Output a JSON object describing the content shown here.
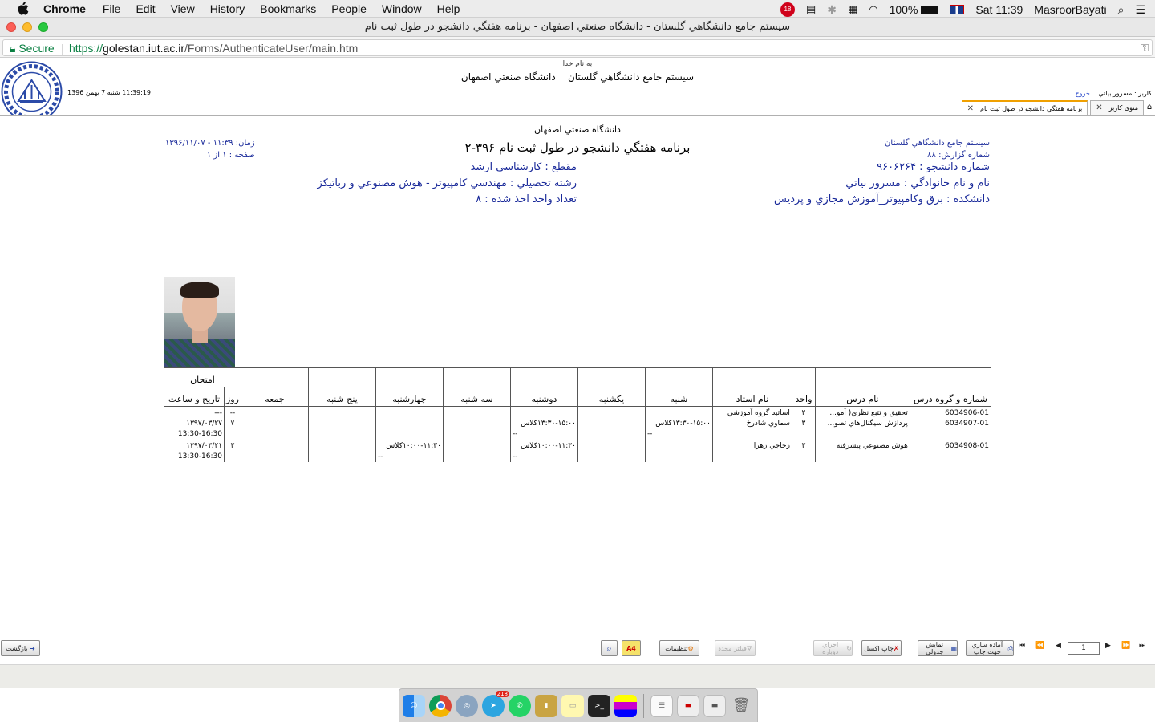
{
  "menubar": {
    "app_name": "Chrome",
    "menus": [
      "File",
      "Edit",
      "View",
      "History",
      "Bookmarks",
      "People",
      "Window",
      "Help"
    ],
    "badge_count": "18",
    "battery": "100%",
    "clock": "Sat 11:39",
    "user": "MasroorBayati"
  },
  "window": {
    "title": "سيستم جامع دانشگاهي گلستان - دانشگاه صنعتي اصفهان - برنامه هفتگي دانشجو در طول ثبت نام"
  },
  "address": {
    "secure_label": "Secure",
    "url_scheme": "https://",
    "url_host": "golestan.iut.ac.ir",
    "url_path": "/Forms/AuthenticateUser/main.htm"
  },
  "header": {
    "basmala": "به نام خدا",
    "system_name": "سيستم جامع دانشگاهي گلستان",
    "university": "دانشگاه صنعتي اصفهان",
    "clock_text": "11:39:19 شنبه 7 بهمن 1396",
    "user_label": "كاربر : مسرور بياتي",
    "logout_label": "خروج"
  },
  "tabs": [
    {
      "label": "برنامه هفتگي دانشجو در طول ثبت نام",
      "active": true
    },
    {
      "label": "منوی کاربر",
      "active": false
    }
  ],
  "report": {
    "university": "دانشگاه صنعتي اصفهان",
    "title": "برنامه هفتگي دانشجو در طول ثبت نام ۳۹۶-۲",
    "system_name": "سيستم جامع دانشگاهي گلستان",
    "report_number": "شماره گزارش: ۸۸",
    "time": "زمان: ۱۱:۳۹ - ۱۳۹۶/۱۱/۰۷",
    "page": "صفحه : ۱ از ۱",
    "student_number": "شماره دانشجو : ۹۶۰۶۲۶۴",
    "student_name": "نام و نام خانوادگي : مسرور بياتي",
    "faculty": "دانشكده : برق وكامپيوتر_آموزش مجازي و پرديس",
    "grade": "مقطع : كارشناسي ارشد",
    "major": "رشته تحصيلي : مهندسي كامپيوتر - هوش مصنوعي و رباتيكز",
    "units_taken": "تعداد واحد اخذ شده : ۸"
  },
  "table": {
    "headers": {
      "course_code": "شماره و گروه درس",
      "course_name": "نام درس",
      "units": "واحد",
      "instructor": "نام استاد",
      "sat": "شنبه",
      "sun": "يكشنبه",
      "mon": "دوشنبه",
      "tue": "سه شنبه",
      "wed": "چهارشنبه",
      "thu": "پنج شنبه",
      "fri": "جمعه",
      "exam": "امتحان",
      "exam_day": "روز",
      "exam_datetime": "تاريخ و ساعت"
    },
    "rows": [
      {
        "code": "6034906-01",
        "name": "تحقيق و تتبع نظري( آمو...",
        "units": "۲",
        "instructor": "اساتيد گروه آموزشي",
        "sat": "",
        "sat2": "",
        "mon": "",
        "mon2": "",
        "wed": "",
        "wed2": "",
        "exam_day": "--",
        "exam_date": "---",
        "exam_time": ""
      },
      {
        "code": "6034907-01",
        "name": "پردازش سيگنال‌هاي تصو...",
        "units": "۳",
        "instructor": "سماوي شادرخ",
        "sat": "۱۳:۳۰-۱۵:۰۰كلاس",
        "sat2": "--",
        "mon": "۱۳:۳۰-۱۵:۰۰كلاس",
        "mon2": "--",
        "wed": "",
        "wed2": "",
        "exam_day": "۷",
        "exam_date": "۱۳۹۷/۰۳/۲۷",
        "exam_time": "13:30-16:30"
      },
      {
        "code": "6034908-01",
        "name": "هوش مصنوعي پيشرفته",
        "units": "۳",
        "instructor": "زجاجي زهرا",
        "sat": "",
        "sat2": "",
        "mon": "۱۰:۰۰-۱۱:۳۰كلاس",
        "mon2": "--",
        "wed": "۱۰:۰۰-۱۱:۳۰كلاس",
        "wed2": "--",
        "exam_day": "۳",
        "exam_date": "۱۳۹۷/۰۳/۲۱",
        "exam_time": "13:30-16:30"
      }
    ]
  },
  "toolbar": {
    "back": "بازگشت",
    "settings": "تنظيمات",
    "a4": "A4",
    "filter": "فيلتر مجدد",
    "rerun": "اجراي دوباره",
    "print_excel": "چاپ اكسل",
    "show_table": "نمايش جدولي",
    "prepare_print": "آماده سازي جهت چاپ",
    "page_value": "1"
  },
  "dock": {
    "telegram_badge": "218"
  }
}
